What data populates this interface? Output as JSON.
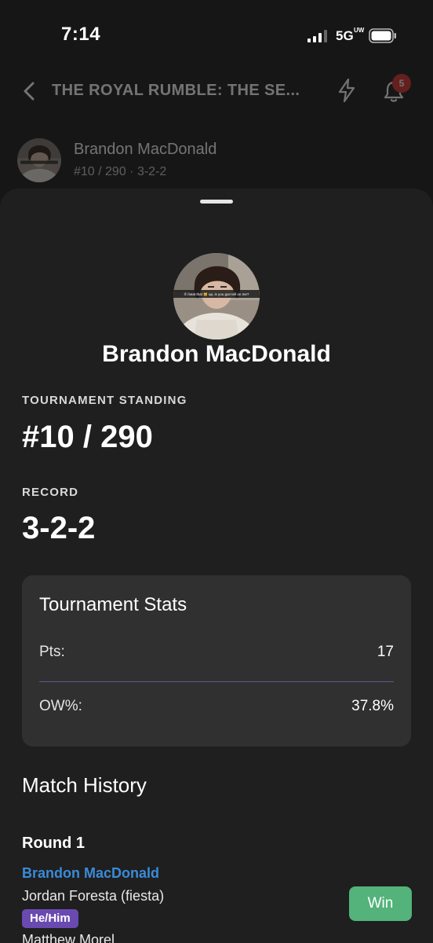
{
  "status_bar": {
    "time": "7:14",
    "network": "5G",
    "network_sub": "UW"
  },
  "header": {
    "title": "THE ROYAL RUMBLE: THE SE...",
    "notification_count": "5"
  },
  "peek": {
    "name": "Brandon MacDonald",
    "sub": "#10 / 290 · 3-2-2"
  },
  "profile": {
    "name": "Brandon MacDonald",
    "avatar_caption": "if i beat that 🐱 up, is you gon tell on me?"
  },
  "standing": {
    "label": "TOURNAMENT STANDING",
    "value": "#10 / 290"
  },
  "record": {
    "label": "RECORD",
    "value": "3-2-2"
  },
  "stats": {
    "title": "Tournament Stats",
    "rows": [
      {
        "label": "Pts:",
        "value": "17"
      },
      {
        "label": "OW%:",
        "value": "37.8%"
      }
    ]
  },
  "match_history": {
    "title": "Match History",
    "rounds": [
      {
        "label": "Round 1",
        "player": "Brandon MacDonald",
        "opponent": "Jordan Foresta (fiesta)",
        "pronoun": "He/Him",
        "next": "Matthew Morel",
        "result": "Win"
      }
    ]
  },
  "colors": {
    "background": "#161616",
    "sheet": "#1f1f1f",
    "card": "#303030",
    "link": "#3a8bd8",
    "win": "#53b37a",
    "badge": "#d7302a",
    "pronoun": "#6a4ab0"
  }
}
